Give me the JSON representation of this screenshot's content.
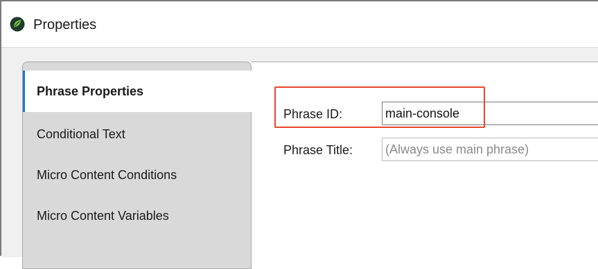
{
  "window": {
    "title": "Properties",
    "app_icon": "leaf-icon"
  },
  "tabs": [
    {
      "label": "Phrase Properties",
      "active": true
    },
    {
      "label": "Conditional Text",
      "active": false
    },
    {
      "label": "Micro Content Conditions",
      "active": false
    },
    {
      "label": "Micro Content Variables",
      "active": false
    }
  ],
  "form": {
    "phrase_id_label": "Phrase ID:",
    "phrase_id_value": "main-console",
    "phrase_title_label": "Phrase Title:",
    "phrase_title_placeholder": "(Always use main phrase)"
  },
  "colors": {
    "highlight": "#e8472a",
    "active_tab_indicator": "#1e78d2",
    "app_icon_green": "#5aa832"
  }
}
